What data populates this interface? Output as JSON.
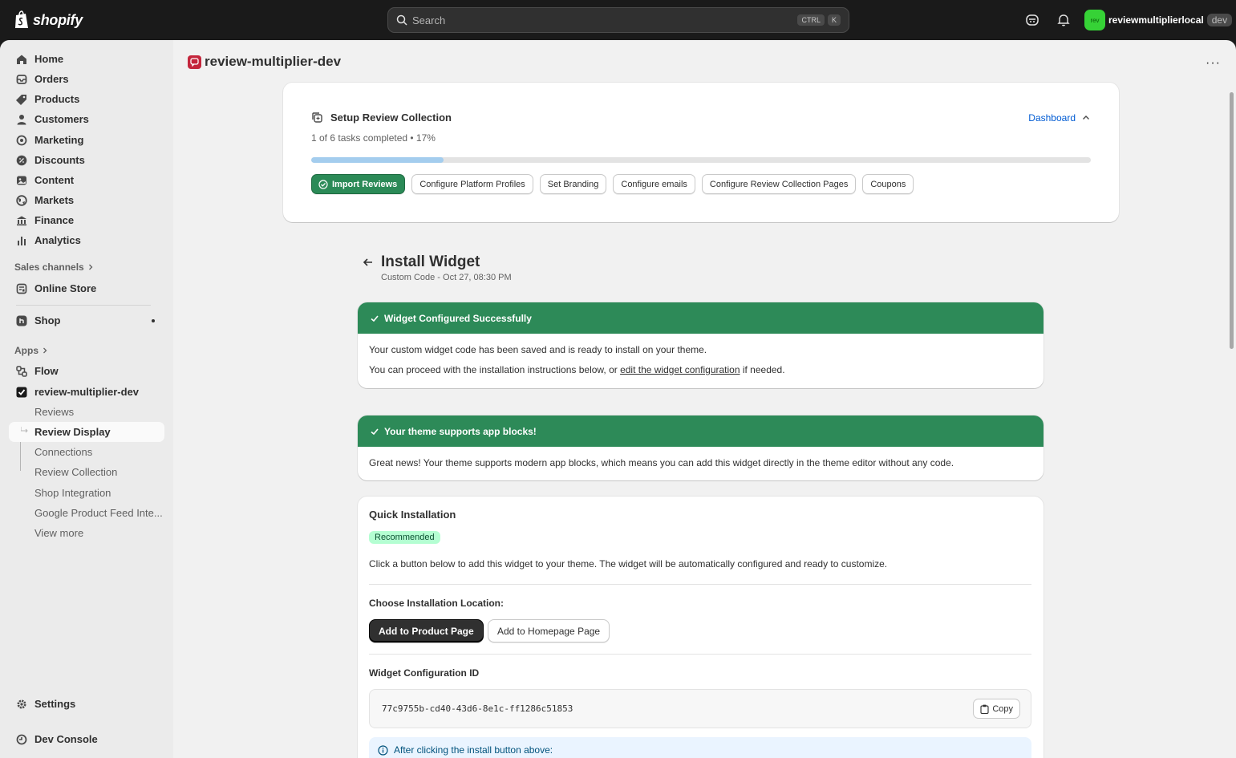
{
  "topbar": {
    "brand": "shopify",
    "search_placeholder": "Search",
    "kbd_ctrl": "CTRL",
    "kbd_k": "K",
    "store_avatar": "rev",
    "store_name": "reviewmultiplierlocal",
    "store_badge": "dev"
  },
  "sidebar": {
    "items": [
      {
        "label": "Home",
        "icon": "home-icon"
      },
      {
        "label": "Orders",
        "icon": "orders-icon"
      },
      {
        "label": "Products",
        "icon": "tag-icon"
      },
      {
        "label": "Customers",
        "icon": "person-icon"
      },
      {
        "label": "Marketing",
        "icon": "target-icon"
      },
      {
        "label": "Discounts",
        "icon": "discount-icon"
      },
      {
        "label": "Content",
        "icon": "content-icon"
      },
      {
        "label": "Markets",
        "icon": "globe-icon"
      },
      {
        "label": "Finance",
        "icon": "bank-icon"
      },
      {
        "label": "Analytics",
        "icon": "bar-chart-icon"
      }
    ],
    "sales_channels_label": "Sales channels",
    "online_store": "Online Store",
    "shop": "Shop",
    "apps_label": "Apps",
    "flow": "Flow",
    "app_name": "review-multiplier-dev",
    "app_sub_items": [
      "Reviews",
      "Review Display",
      "Connections",
      "Review Collection",
      "Shop Integration",
      "Google Product Feed Inte...",
      "View more"
    ],
    "active_sub_item": "Review Display",
    "settings": "Settings",
    "dev_console": "Dev Console"
  },
  "header": {
    "app_title": "review-multiplier-dev",
    "more": "···"
  },
  "setup": {
    "title": "Setup Review Collection",
    "progress_text": "1 of 6 tasks completed • 17%",
    "progress_fraction": 0.17,
    "dashboard_link": "Dashboard",
    "tasks": [
      "Import Reviews",
      "Configure Platform Profiles",
      "Set Branding",
      "Configure emails",
      "Configure Review Collection Pages",
      "Coupons"
    ],
    "completed_task": "Import Reviews"
  },
  "page": {
    "title": "Install Widget",
    "subtitle": "Custom Code - Oct 27, 08:30 PM"
  },
  "banner_configured": {
    "title": "Widget Configured Successfully",
    "line1": "Your custom widget code has been saved and is ready to install on your theme.",
    "line2_prefix": "You can proceed with the installation instructions below, or ",
    "line2_link": "edit the widget configuration",
    "line2_suffix": " if needed."
  },
  "banner_theme": {
    "title": "Your theme supports app blocks!",
    "body": "Great news! Your theme supports modern app blocks, which means you can add this widget directly in the theme editor without any code."
  },
  "quick_install": {
    "title": "Quick Installation",
    "badge": "Recommended",
    "description": "Click a button below to add this widget to your theme. The widget will be automatically configured and ready to customize.",
    "location_label": "Choose Installation Location:",
    "primary_button": "Add to Product Page",
    "secondary_button": "Add to Homepage Page",
    "config_id_label": "Widget Configuration ID",
    "config_id": "77c9755b-cd40-43d6-8e1c-ff1286c51853",
    "copy_button": "Copy",
    "info_text": "After clicking the install button above:"
  },
  "colors": {
    "success": "#2d8a58",
    "progress": "#a4cdee",
    "link": "#005bd3",
    "badge_bg": "#b4fed2"
  }
}
